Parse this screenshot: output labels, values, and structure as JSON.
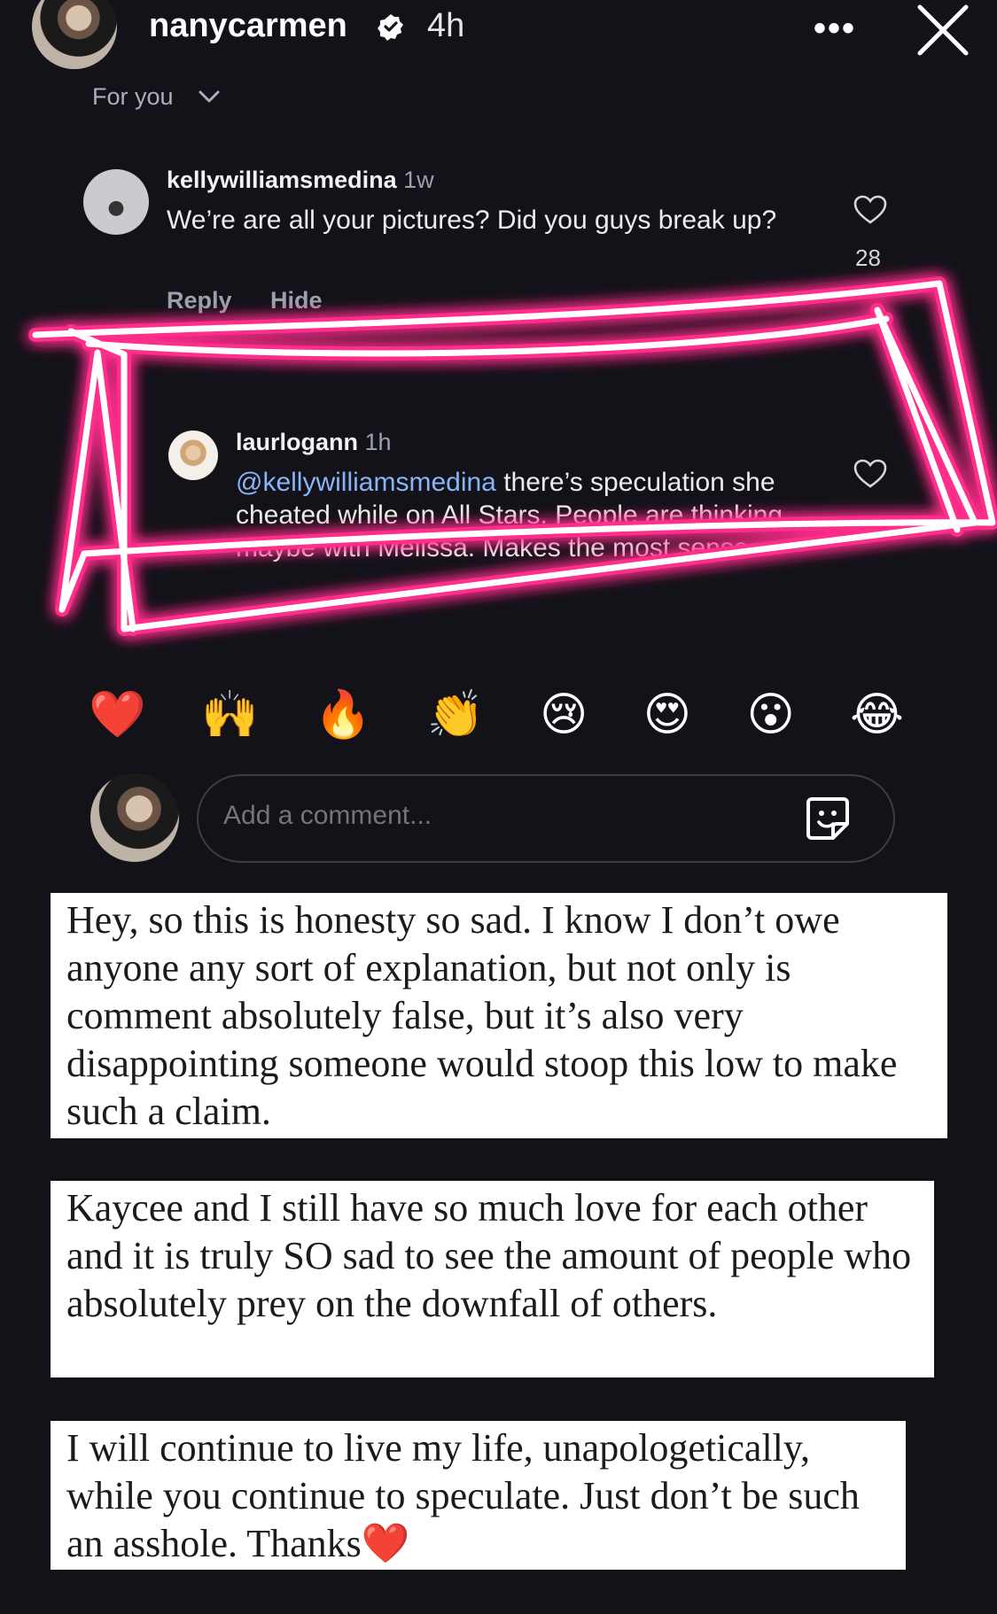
{
  "header": {
    "username": "nanycarmen",
    "time": "4h",
    "more_label": "•••"
  },
  "filter": {
    "label": "For you"
  },
  "comments": [
    {
      "user": "kellywilliamsmedina",
      "ago": "1w",
      "text": "We’re are all your pictures? Did you guys break up?",
      "likes": "28",
      "reply_label": "Reply",
      "hide_label": "Hide"
    },
    {
      "user": "laurlogann",
      "ago": "1h",
      "mention": "@kellywilliamsmedina",
      "text": " there’s speculation she cheated while on All Stars. People are thinking maybe with Melissa. Makes the most sense."
    }
  ],
  "reactions": [
    "❤️",
    "🙌",
    "🔥",
    "👏",
    "😢",
    "😍",
    "😮",
    "😂"
  ],
  "add_comment": {
    "placeholder": "Add a comment..."
  },
  "cards": [
    "Hey, so this is honesty so sad. I know I don’t owe anyone any sort of explanation, but not only is comment absolutely false, but it’s also very disappointing someone would stoop this low to make such a claim.",
    "Kaycee and I still have so much love for each other and it is truly SO sad to see the amount of people who absolutely prey on the downfall of others.",
    "I will continue to live my life, unapologetically, while you continue to speculate. Just don’t be such an asshole. Thanks❤️"
  ],
  "colors": {
    "background": "#121218",
    "neon": "#ff2d8a",
    "mention": "#8ab4f8"
  }
}
